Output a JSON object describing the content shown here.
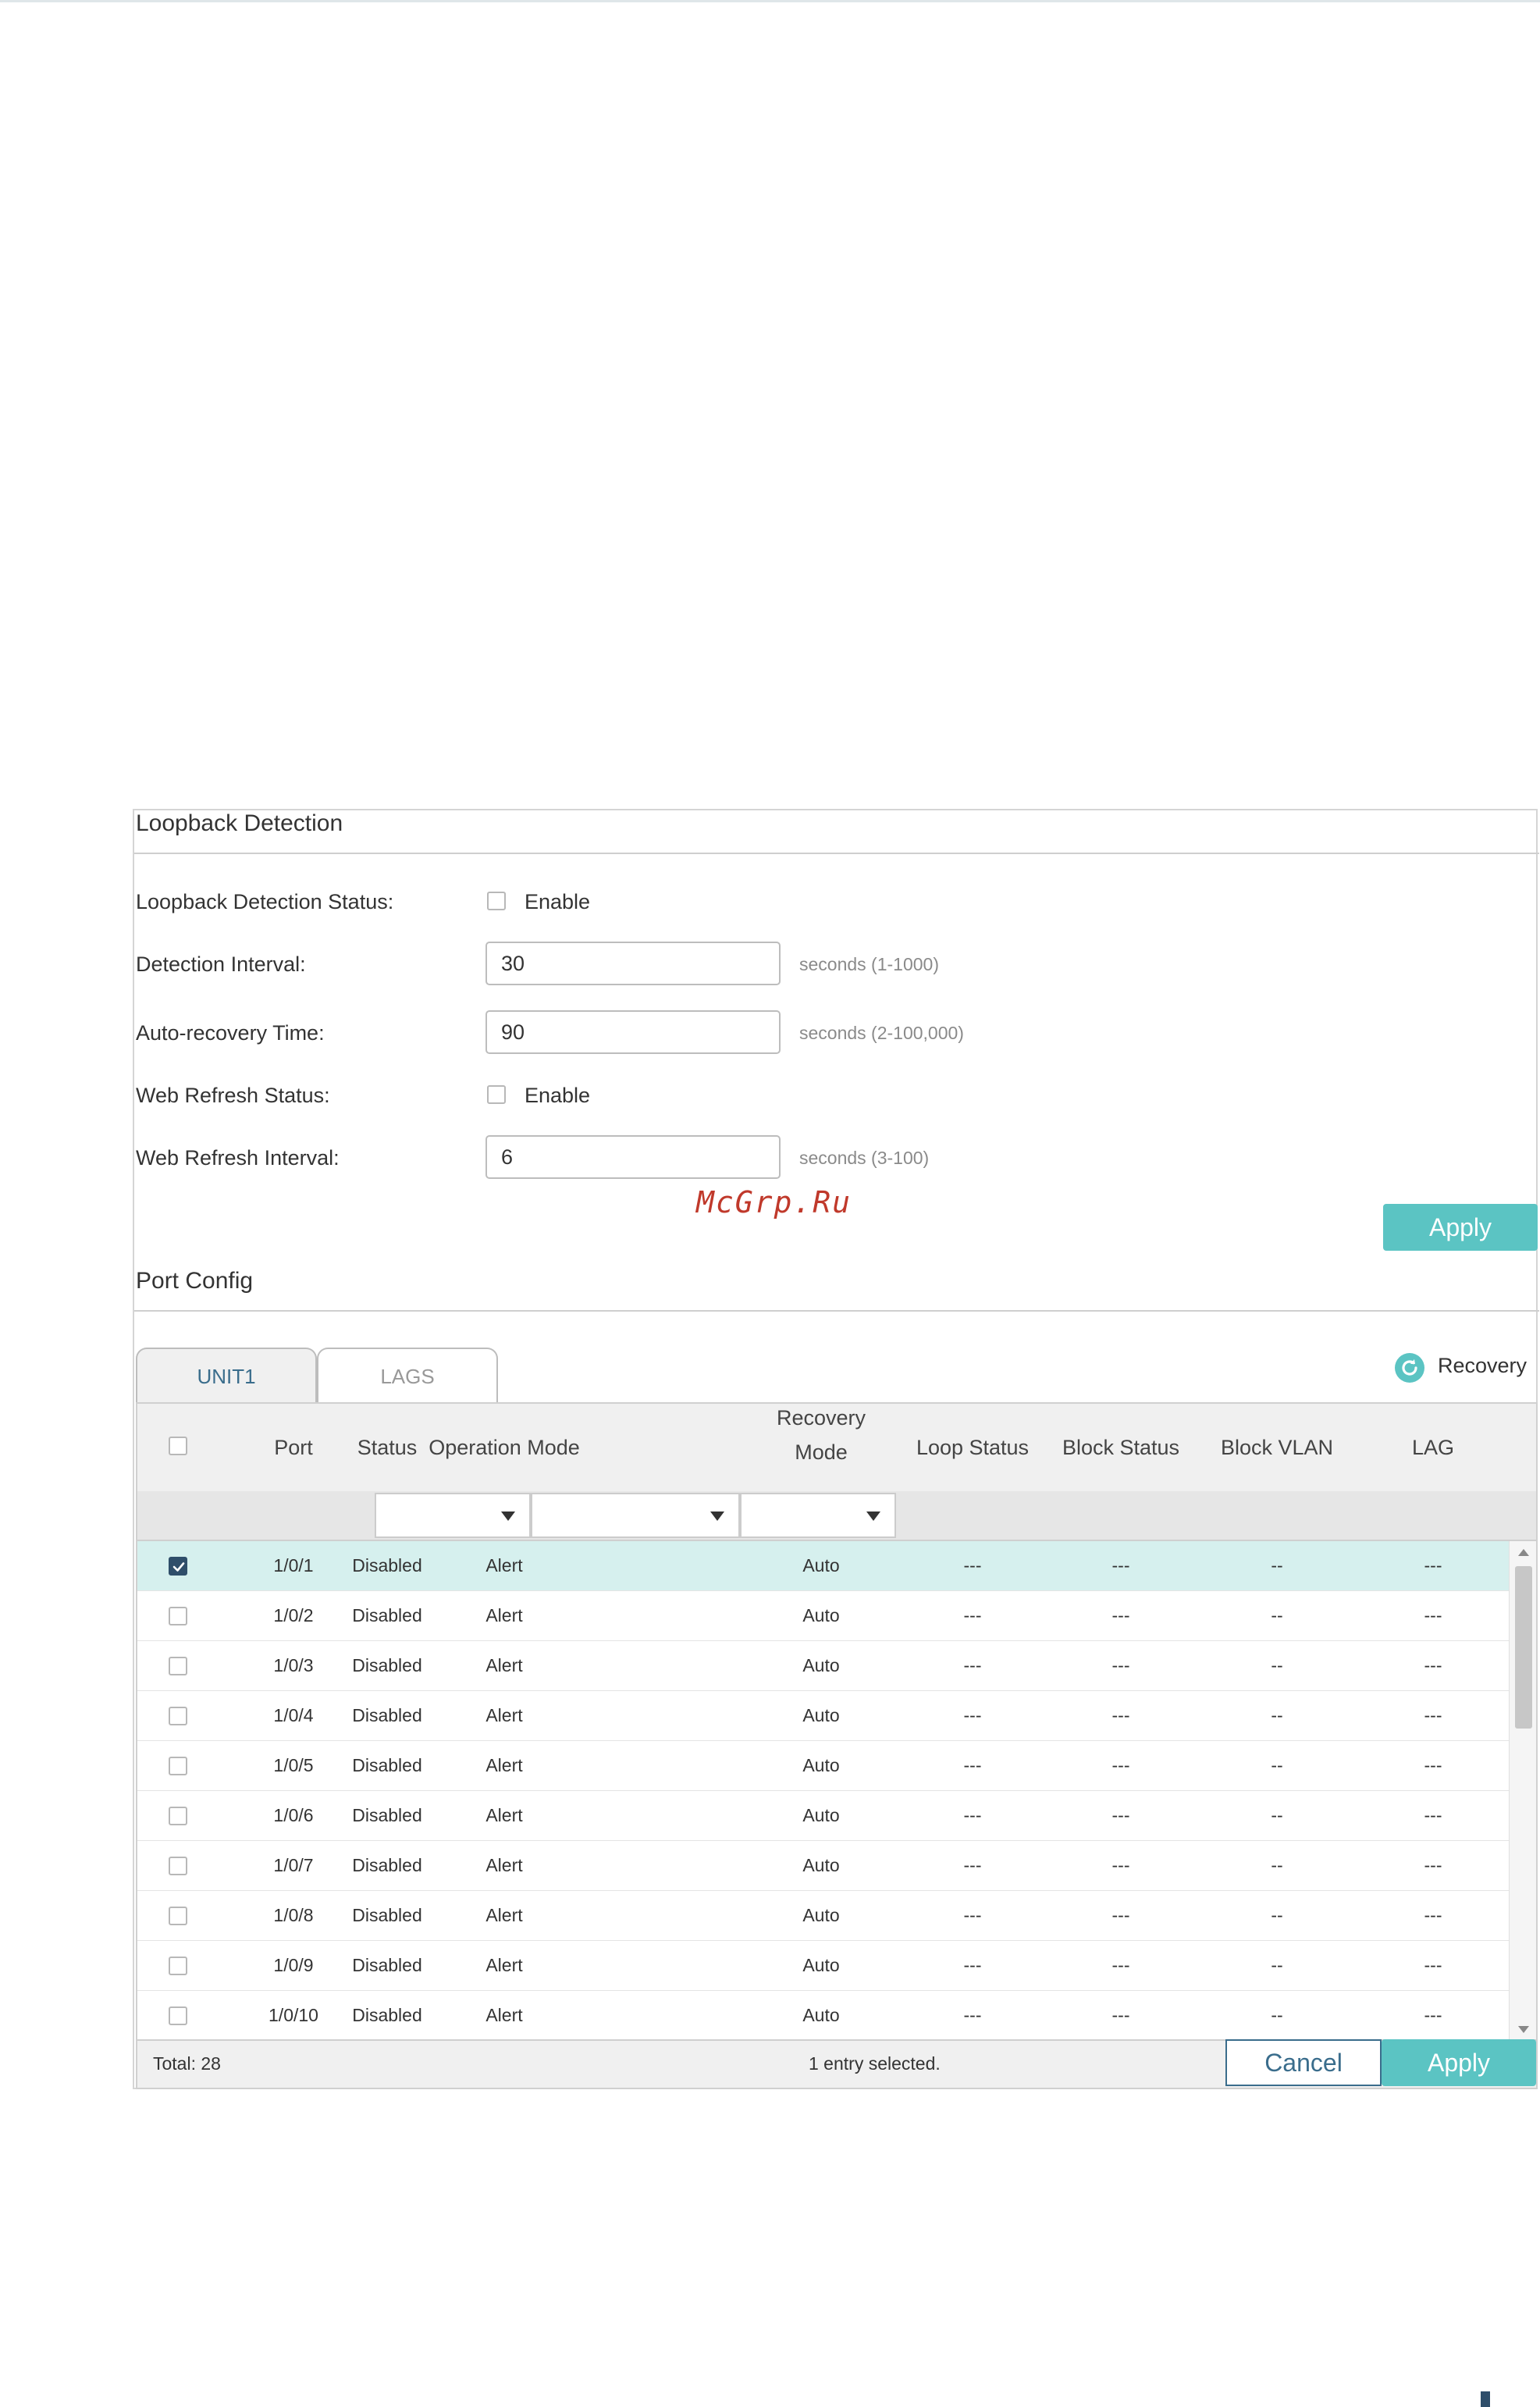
{
  "loopback": {
    "title": "Loopback Detection",
    "status_label": "Loopback Detection Status:",
    "status_enable": "Enable",
    "interval_label": "Detection Interval:",
    "interval_value": "30",
    "interval_hint": "seconds (1-1000)",
    "recovery_label": "Auto-recovery Time:",
    "recovery_value": "90",
    "recovery_hint": "seconds (2-100,000)",
    "web_refresh_status_label": "Web Refresh Status:",
    "web_refresh_enable": "Enable",
    "web_refresh_interval_label": "Web Refresh Interval:",
    "web_refresh_interval_value": "6",
    "web_refresh_interval_hint": "seconds (3-100)",
    "apply_label": "Apply"
  },
  "watermark": "McGrp.Ru",
  "port_config": {
    "title": "Port Config",
    "tabs": [
      {
        "label": "UNIT1",
        "active": true
      },
      {
        "label": "LAGS",
        "active": false
      }
    ],
    "recovery_label": "Recovery",
    "columns": [
      "Port",
      "Status",
      "Operation Mode",
      "Recovery",
      "Mode",
      "Loop Status",
      "Block Status",
      "Block VLAN",
      "LAG"
    ],
    "rows": [
      {
        "port": "1/0/1",
        "status": "Disabled",
        "op_mode": "Alert",
        "rec_mode": "Auto",
        "loop": "---",
        "block": "---",
        "vlan": "--",
        "lag": "---",
        "checked": true
      },
      {
        "port": "1/0/2",
        "status": "Disabled",
        "op_mode": "Alert",
        "rec_mode": "Auto",
        "loop": "---",
        "block": "---",
        "vlan": "--",
        "lag": "---",
        "checked": false
      },
      {
        "port": "1/0/3",
        "status": "Disabled",
        "op_mode": "Alert",
        "rec_mode": "Auto",
        "loop": "---",
        "block": "---",
        "vlan": "--",
        "lag": "---",
        "checked": false
      },
      {
        "port": "1/0/4",
        "status": "Disabled",
        "op_mode": "Alert",
        "rec_mode": "Auto",
        "loop": "---",
        "block": "---",
        "vlan": "--",
        "lag": "---",
        "checked": false
      },
      {
        "port": "1/0/5",
        "status": "Disabled",
        "op_mode": "Alert",
        "rec_mode": "Auto",
        "loop": "---",
        "block": "---",
        "vlan": "--",
        "lag": "---",
        "checked": false
      },
      {
        "port": "1/0/6",
        "status": "Disabled",
        "op_mode": "Alert",
        "rec_mode": "Auto",
        "loop": "---",
        "block": "---",
        "vlan": "--",
        "lag": "---",
        "checked": false
      },
      {
        "port": "1/0/7",
        "status": "Disabled",
        "op_mode": "Alert",
        "rec_mode": "Auto",
        "loop": "---",
        "block": "---",
        "vlan": "--",
        "lag": "---",
        "checked": false
      },
      {
        "port": "1/0/8",
        "status": "Disabled",
        "op_mode": "Alert",
        "rec_mode": "Auto",
        "loop": "---",
        "block": "---",
        "vlan": "--",
        "lag": "---",
        "checked": false
      },
      {
        "port": "1/0/9",
        "status": "Disabled",
        "op_mode": "Alert",
        "rec_mode": "Auto",
        "loop": "---",
        "block": "---",
        "vlan": "--",
        "lag": "---",
        "checked": false
      },
      {
        "port": "1/0/10",
        "status": "Disabled",
        "op_mode": "Alert",
        "rec_mode": "Auto",
        "loop": "---",
        "block": "---",
        "vlan": "--",
        "lag": "---",
        "checked": false
      }
    ],
    "total": "Total: 28",
    "selected_text": "1 entry selected.",
    "cancel_label": "Cancel",
    "apply_label": "Apply"
  },
  "colors": {
    "accent": "#5bc4c3",
    "selected_row": "#d6f0ee",
    "checkbox_checked": "#2f4e6a",
    "tab_active_text": "#3a6d8c"
  },
  "icons": [
    "refresh-icon",
    "check-icon",
    "dropdown-caret-icon",
    "scroll-up-icon",
    "scroll-down-icon"
  ]
}
